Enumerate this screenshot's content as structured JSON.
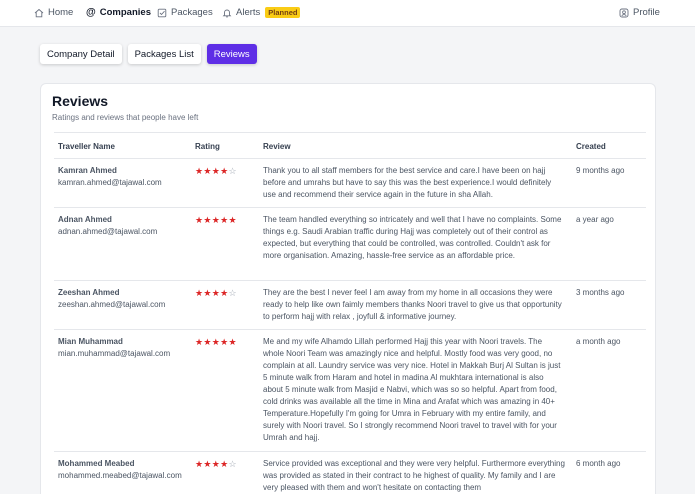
{
  "nav": {
    "items": [
      {
        "label": "Home",
        "icon": "home-icon"
      },
      {
        "label": "Companies",
        "icon": "at-icon"
      },
      {
        "label": "Packages",
        "icon": "check-square-icon"
      },
      {
        "label": "Alerts",
        "icon": "bell-icon"
      }
    ],
    "alerts_badge": "Planned",
    "profile": "Profile"
  },
  "tabs": [
    "Company Detail",
    "Packages List",
    "Reviews"
  ],
  "active_tab": "Reviews",
  "accent_color": "#5e2ee6",
  "star_color": "#dc2626",
  "reviews": {
    "title": "Reviews",
    "subtitle": "Ratings and reviews that people have left",
    "headers": {
      "traveller": "Traveller Name",
      "rating": "Rating",
      "review": "Review",
      "created": "Created"
    },
    "rows": [
      {
        "name": "Kamran Ahmed",
        "email": "kamran.ahmed@tajawal.com",
        "rating": 4,
        "review": "Thank you to all staff members for the best service and care.I have been on hajj before and umrahs but have to say this was the best experience.I would definitely use and recommend their service again in the future in sha Allah.",
        "created": "9 months ago"
      },
      {
        "name": "Adnan Ahmed",
        "email": "adnan.ahmed@tajawal.com",
        "rating": 5,
        "review": "The team handled everything so intricately and well that I have no complaints. Some things e.g. Saudi Arabian traffic during Hajj was completely out of their control as expected, but everything that could be controlled, was controlled. Couldn't ask for more organisation. Amazing, hassle-free service as an affordable price.",
        "created": "a year ago"
      },
      {
        "name": "Zeeshan Ahmed",
        "email": "zeeshan.ahmed@tajawal.com",
        "rating": 4,
        "review": "They are the best I never feel I am away from my home in all occasions they were ready to help like own faimly members thanks Noori travel to give us that opportunity to perform hajj with relax , joyfull & informative journey.",
        "created": "3 months ago"
      },
      {
        "name": "Mian Muhammad",
        "email": "mian.muhammad@tajawal.com",
        "rating": 5,
        "review": "Me and my wife Alhamdo Lillah performed Hajj this year with Noori travels. The whole Noori Team was amazingly nice and helpful. Mostly food was very good, no complain at all. Laundry service was very nice. Hotel in Makkah Burj Al Sultan is just 5 minute walk from Haram and hotel in madina Al mukhtara international is also about 5 minute walk from Masjid e Nabvi, which was so so helpful. Apart from food, cold drinks was available all the time in Mina and Arafat which was amazing in 40+ Temperature.Hopefully I'm going for Umra in February with my entire family, and surely with Noori travel. So I strongly recommend Noori travel to travel with for your Umrah and hajj.",
        "created": "a month ago"
      },
      {
        "name": "Mohammed Meabed",
        "email": "mohammed.meabed@tajawal.com",
        "rating": 4,
        "review": "Service provided was exceptional and they were very helpful. Furthermore everything was provided as stated in their contract to he highest of quality. My family and I are very pleased with them and won't hesitate on contacting them",
        "created": "6 month ago"
      }
    ]
  }
}
